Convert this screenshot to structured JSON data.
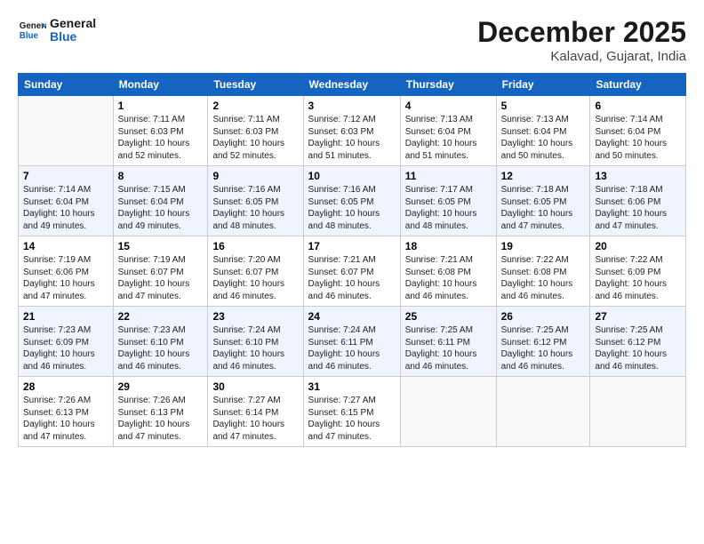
{
  "header": {
    "logo_line1": "General",
    "logo_line2": "Blue",
    "month_title": "December 2025",
    "location": "Kalavad, Gujarat, India"
  },
  "weekdays": [
    "Sunday",
    "Monday",
    "Tuesday",
    "Wednesday",
    "Thursday",
    "Friday",
    "Saturday"
  ],
  "weeks": [
    [
      {
        "day": "",
        "info": ""
      },
      {
        "day": "1",
        "info": "Sunrise: 7:11 AM\nSunset: 6:03 PM\nDaylight: 10 hours\nand 52 minutes."
      },
      {
        "day": "2",
        "info": "Sunrise: 7:11 AM\nSunset: 6:03 PM\nDaylight: 10 hours\nand 52 minutes."
      },
      {
        "day": "3",
        "info": "Sunrise: 7:12 AM\nSunset: 6:03 PM\nDaylight: 10 hours\nand 51 minutes."
      },
      {
        "day": "4",
        "info": "Sunrise: 7:13 AM\nSunset: 6:04 PM\nDaylight: 10 hours\nand 51 minutes."
      },
      {
        "day": "5",
        "info": "Sunrise: 7:13 AM\nSunset: 6:04 PM\nDaylight: 10 hours\nand 50 minutes."
      },
      {
        "day": "6",
        "info": "Sunrise: 7:14 AM\nSunset: 6:04 PM\nDaylight: 10 hours\nand 50 minutes."
      }
    ],
    [
      {
        "day": "7",
        "info": "Sunrise: 7:14 AM\nSunset: 6:04 PM\nDaylight: 10 hours\nand 49 minutes."
      },
      {
        "day": "8",
        "info": "Sunrise: 7:15 AM\nSunset: 6:04 PM\nDaylight: 10 hours\nand 49 minutes."
      },
      {
        "day": "9",
        "info": "Sunrise: 7:16 AM\nSunset: 6:05 PM\nDaylight: 10 hours\nand 48 minutes."
      },
      {
        "day": "10",
        "info": "Sunrise: 7:16 AM\nSunset: 6:05 PM\nDaylight: 10 hours\nand 48 minutes."
      },
      {
        "day": "11",
        "info": "Sunrise: 7:17 AM\nSunset: 6:05 PM\nDaylight: 10 hours\nand 48 minutes."
      },
      {
        "day": "12",
        "info": "Sunrise: 7:18 AM\nSunset: 6:05 PM\nDaylight: 10 hours\nand 47 minutes."
      },
      {
        "day": "13",
        "info": "Sunrise: 7:18 AM\nSunset: 6:06 PM\nDaylight: 10 hours\nand 47 minutes."
      }
    ],
    [
      {
        "day": "14",
        "info": "Sunrise: 7:19 AM\nSunset: 6:06 PM\nDaylight: 10 hours\nand 47 minutes."
      },
      {
        "day": "15",
        "info": "Sunrise: 7:19 AM\nSunset: 6:07 PM\nDaylight: 10 hours\nand 47 minutes."
      },
      {
        "day": "16",
        "info": "Sunrise: 7:20 AM\nSunset: 6:07 PM\nDaylight: 10 hours\nand 46 minutes."
      },
      {
        "day": "17",
        "info": "Sunrise: 7:21 AM\nSunset: 6:07 PM\nDaylight: 10 hours\nand 46 minutes."
      },
      {
        "day": "18",
        "info": "Sunrise: 7:21 AM\nSunset: 6:08 PM\nDaylight: 10 hours\nand 46 minutes."
      },
      {
        "day": "19",
        "info": "Sunrise: 7:22 AM\nSunset: 6:08 PM\nDaylight: 10 hours\nand 46 minutes."
      },
      {
        "day": "20",
        "info": "Sunrise: 7:22 AM\nSunset: 6:09 PM\nDaylight: 10 hours\nand 46 minutes."
      }
    ],
    [
      {
        "day": "21",
        "info": "Sunrise: 7:23 AM\nSunset: 6:09 PM\nDaylight: 10 hours\nand 46 minutes."
      },
      {
        "day": "22",
        "info": "Sunrise: 7:23 AM\nSunset: 6:10 PM\nDaylight: 10 hours\nand 46 minutes."
      },
      {
        "day": "23",
        "info": "Sunrise: 7:24 AM\nSunset: 6:10 PM\nDaylight: 10 hours\nand 46 minutes."
      },
      {
        "day": "24",
        "info": "Sunrise: 7:24 AM\nSunset: 6:11 PM\nDaylight: 10 hours\nand 46 minutes."
      },
      {
        "day": "25",
        "info": "Sunrise: 7:25 AM\nSunset: 6:11 PM\nDaylight: 10 hours\nand 46 minutes."
      },
      {
        "day": "26",
        "info": "Sunrise: 7:25 AM\nSunset: 6:12 PM\nDaylight: 10 hours\nand 46 minutes."
      },
      {
        "day": "27",
        "info": "Sunrise: 7:25 AM\nSunset: 6:12 PM\nDaylight: 10 hours\nand 46 minutes."
      }
    ],
    [
      {
        "day": "28",
        "info": "Sunrise: 7:26 AM\nSunset: 6:13 PM\nDaylight: 10 hours\nand 47 minutes."
      },
      {
        "day": "29",
        "info": "Sunrise: 7:26 AM\nSunset: 6:13 PM\nDaylight: 10 hours\nand 47 minutes."
      },
      {
        "day": "30",
        "info": "Sunrise: 7:27 AM\nSunset: 6:14 PM\nDaylight: 10 hours\nand 47 minutes."
      },
      {
        "day": "31",
        "info": "Sunrise: 7:27 AM\nSunset: 6:15 PM\nDaylight: 10 hours\nand 47 minutes."
      },
      {
        "day": "",
        "info": ""
      },
      {
        "day": "",
        "info": ""
      },
      {
        "day": "",
        "info": ""
      }
    ]
  ]
}
